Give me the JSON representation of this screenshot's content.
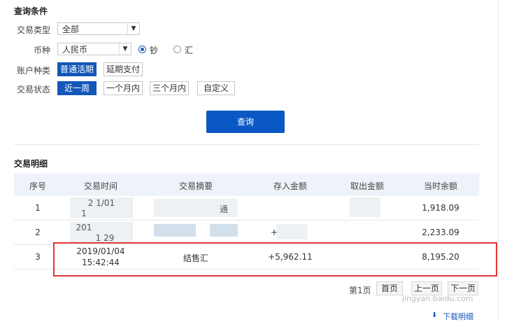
{
  "filters": {
    "title": "查询条件",
    "type_label": "交易类型",
    "type_value": "全部",
    "currency_label": "币种",
    "currency_value": "人民币",
    "cash_label": "钞",
    "remit_label": "汇",
    "account_label": "账户种类",
    "account_options": [
      "普通活期",
      "延期支付"
    ],
    "status_label": "交易状态",
    "status_options": [
      "近一周",
      "一个月内",
      "三个月内",
      "自定义"
    ],
    "query_button": "查询"
  },
  "details": {
    "title": "交易明细",
    "columns": [
      "序号",
      "交易时间",
      "交易摘要",
      "存入金额",
      "取出金额",
      "当时余额"
    ],
    "rows": [
      {
        "no": "1",
        "date": "2 1/01",
        "time": "1",
        "summary": "通",
        "deposit": "",
        "withdraw": "",
        "balance": "1,918.09"
      },
      {
        "no": "2",
        "date": "201",
        "time": "1 29",
        "summary": "",
        "deposit": "+",
        "withdraw": "",
        "balance": "2,233.09"
      },
      {
        "no": "3",
        "date": "2019/01/04",
        "time": "15:42:44",
        "summary": "结售汇",
        "deposit": "+5,962.11",
        "withdraw": "",
        "balance": "8,195.20"
      }
    ]
  },
  "pagination": {
    "page_info": "第1页",
    "first": "首页",
    "prev": "上一页",
    "next": "下一页"
  },
  "footer": {
    "download": "下载明细",
    "watermark": "jingyan.baidu.com"
  },
  "colors": {
    "accent": "#1457b8",
    "highlight": "#e03535"
  }
}
